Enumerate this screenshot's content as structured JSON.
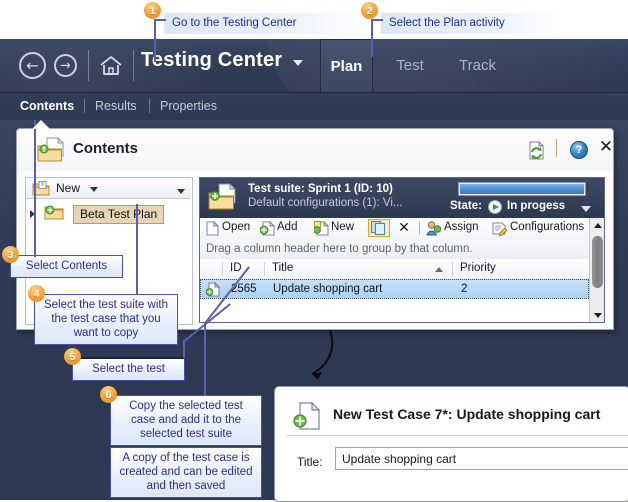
{
  "app": {
    "name": "Testing Center",
    "back_label": "Back",
    "forward_label": "Forward",
    "home_label": "Home",
    "activity_tabs": [
      {
        "label": "Plan",
        "selected": true
      },
      {
        "label": "Test",
        "selected": false
      },
      {
        "label": "Track",
        "selected": false
      }
    ],
    "sub_tabs": [
      {
        "label": "Contents",
        "selected": true
      },
      {
        "label": "Results",
        "selected": false
      },
      {
        "label": "Properties",
        "selected": false
      }
    ]
  },
  "contents_window": {
    "title": "Contents",
    "refresh_label": "Refresh",
    "help_label": "?",
    "close_label": "✕"
  },
  "left_pane": {
    "new_button": "New",
    "tree_item": "Beta Test Plan"
  },
  "suite_header": {
    "title": "Test suite:  Sprint 1 (ID: 10)",
    "subtitle": "Default configurations (1): Vi...",
    "state_label": "State:",
    "state_value": "In progess",
    "progress_percent": 100
  },
  "toolbar": {
    "open": "Open",
    "add": "Add",
    "new": "New",
    "copy": "Copy",
    "delete": "✕",
    "assign": "Assign",
    "configurations": "Configurations"
  },
  "grid": {
    "group_hint": "Drag a column header here to group by that column.",
    "columns": [
      "ID",
      "Title",
      "Priority"
    ],
    "sorted_column": "Title",
    "rows": [
      {
        "id": "2565",
        "title": "Update shopping cart",
        "priority": "2",
        "selected": true
      }
    ]
  },
  "new_test_case": {
    "title": "New Test Case 7*: Update shopping cart",
    "field_label": "Title:",
    "field_value": "Update shopping cart"
  },
  "callouts": [
    {
      "number": "1",
      "text": "Go to the Testing Center"
    },
    {
      "number": "2",
      "text": "Select the Plan activity"
    },
    {
      "number": "3",
      "text": "Select Contents"
    },
    {
      "number": "4",
      "text": "Select the test suite with the test case that you want to copy"
    },
    {
      "number": "5",
      "text": "Select the test"
    },
    {
      "number": "6",
      "text": "Copy the selected test case and add it to the selected test suite"
    },
    {
      "number": "",
      "text": "A copy of the test case is created and can be edited and then saved"
    }
  ],
  "colors": {
    "app_band": "#333f59",
    "workspace": "#2e3a54",
    "accent_gold": "#e4b93c",
    "badge_orange": "#f4a63b",
    "callout_text": "#2b2f93",
    "selection_blue": "#a9d2f2",
    "highlight_tan": "#e5d5b6"
  }
}
